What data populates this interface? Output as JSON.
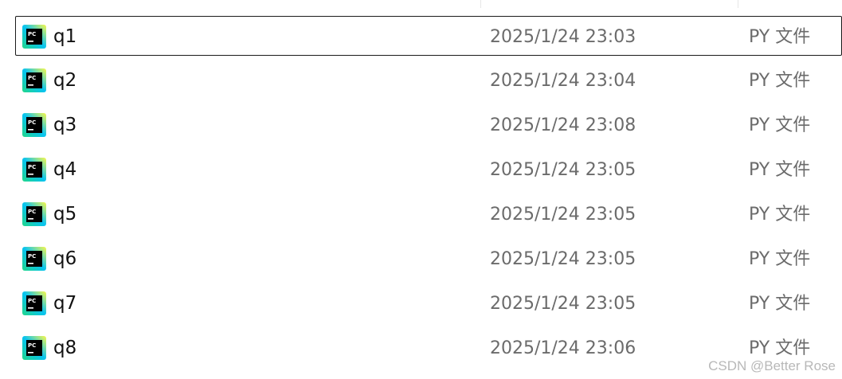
{
  "files": [
    {
      "name": "q1",
      "modified": "2025/1/24 23:03",
      "type": "PY 文件",
      "selected": true
    },
    {
      "name": "q2",
      "modified": "2025/1/24 23:04",
      "type": "PY 文件"
    },
    {
      "name": "q3",
      "modified": "2025/1/24 23:08",
      "type": "PY 文件"
    },
    {
      "name": "q4",
      "modified": "2025/1/24 23:05",
      "type": "PY 文件"
    },
    {
      "name": "q5",
      "modified": "2025/1/24 23:05",
      "type": "PY 文件"
    },
    {
      "name": "q6",
      "modified": "2025/1/24 23:05",
      "type": "PY 文件"
    },
    {
      "name": "q7",
      "modified": "2025/1/24 23:05",
      "type": "PY 文件"
    },
    {
      "name": "q8",
      "modified": "2025/1/24 23:06",
      "type": "PY 文件"
    }
  ],
  "icon": {
    "name": "pycharm-file-icon",
    "label": "PC"
  },
  "watermark": "CSDN @Better Rose",
  "colors": {
    "selection_border": "#1a1a1a",
    "secondary_text": "#6b6b6b"
  }
}
